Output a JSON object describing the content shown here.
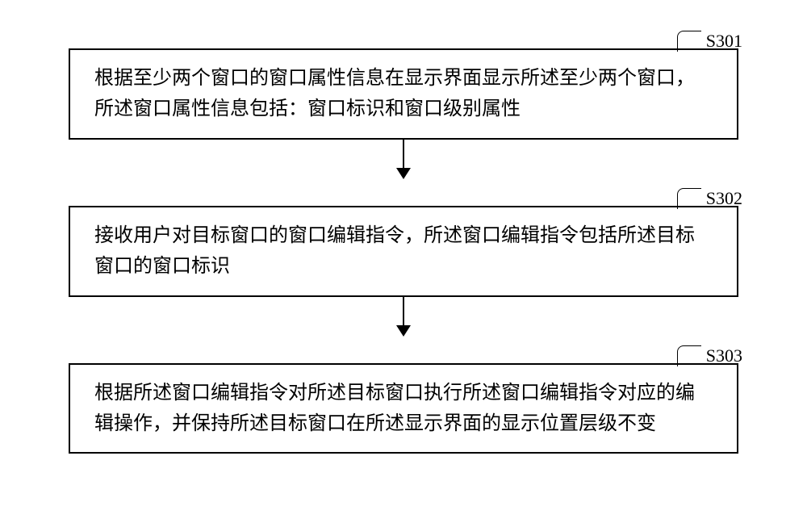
{
  "steps": [
    {
      "label": "S301",
      "text": "根据至少两个窗口的窗口属性信息在显示界面显示所述至少两个窗口，所述窗口属性信息包括：窗口标识和窗口级别属性"
    },
    {
      "label": "S302",
      "text": "接收用户对目标窗口的窗口编辑指令，所述窗口编辑指令包括所述目标窗口的窗口标识"
    },
    {
      "label": "S303",
      "text": "根据所述窗口编辑指令对所述目标窗口执行所述窗口编辑指令对应的编辑操作，并保持所述目标窗口在所述显示界面的显示位置层级不变"
    }
  ]
}
